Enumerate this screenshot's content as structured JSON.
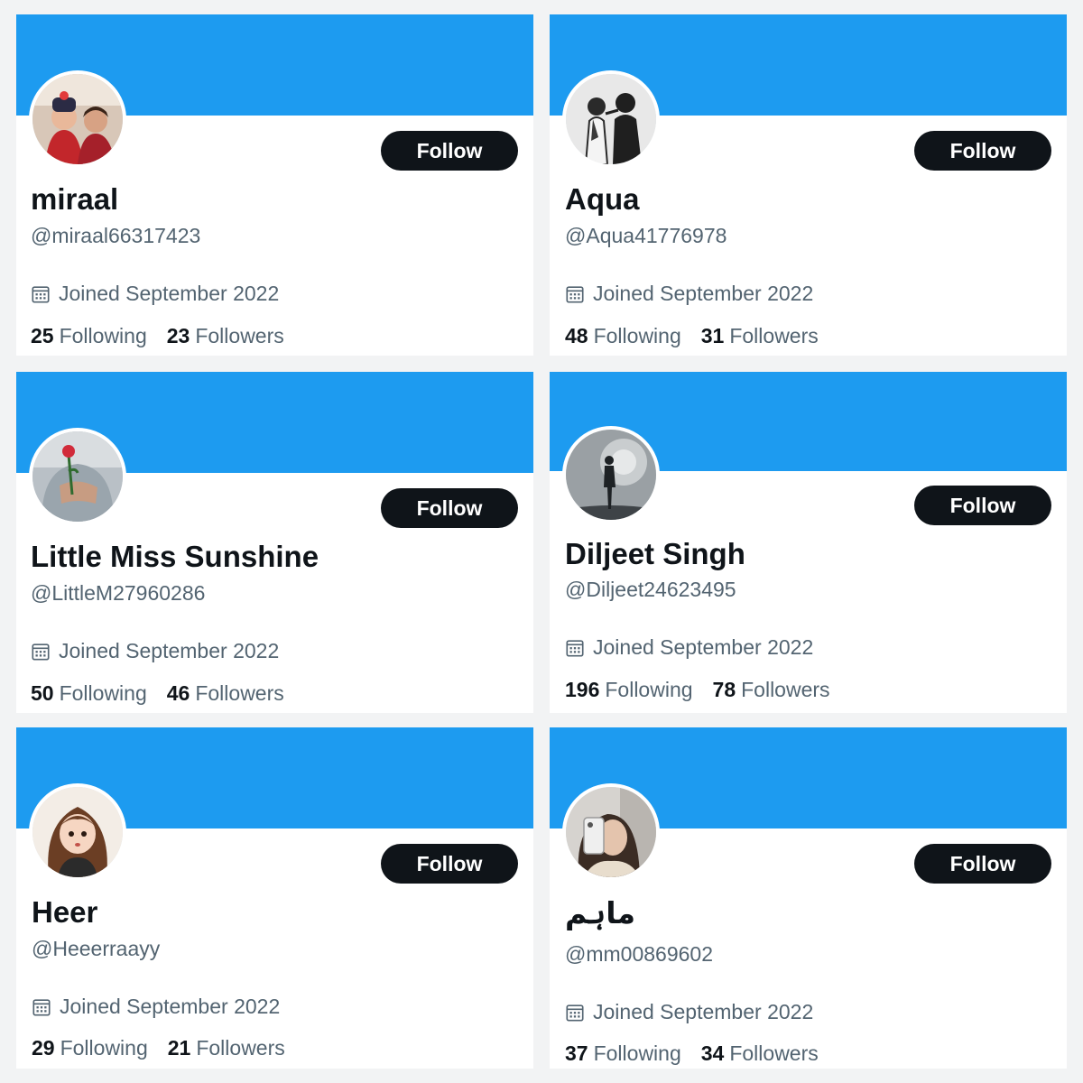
{
  "cards": [
    {
      "name": "miraal",
      "handle": "@miraal66317423",
      "joined": "Joined September 2022",
      "following_count": "25",
      "following_label": "Following",
      "followers_count": "23",
      "followers_label": "Followers",
      "follow_label": "Follow"
    },
    {
      "name": "Aqua",
      "handle": "@Aqua41776978",
      "joined": "Joined September 2022",
      "following_count": "48",
      "following_label": "Following",
      "followers_count": "31",
      "followers_label": "Followers",
      "follow_label": "Follow"
    },
    {
      "name": "Little Miss Sunshine",
      "handle": "@LittleM27960286",
      "joined": "Joined September 2022",
      "following_count": "50",
      "following_label": "Following",
      "followers_count": "46",
      "followers_label": "Followers",
      "follow_label": "Follow"
    },
    {
      "name": "Diljeet Singh",
      "handle": "@Diljeet24623495",
      "joined": "Joined September 2022",
      "following_count": "196",
      "following_label": "Following",
      "followers_count": "78",
      "followers_label": "Followers",
      "follow_label": "Follow"
    },
    {
      "name": "Heer",
      "handle": "@Heeerraayy",
      "joined": "Joined September 2022",
      "following_count": "29",
      "following_label": "Following",
      "followers_count": "21",
      "followers_label": "Followers",
      "follow_label": "Follow"
    },
    {
      "name": "ماہم",
      "handle": "@mm00869602",
      "joined": "Joined September 2022",
      "following_count": "37",
      "following_label": "Following",
      "followers_count": "34",
      "followers_label": "Followers",
      "follow_label": "Follow"
    }
  ],
  "colors": {
    "banner": "#1d9bf0",
    "button": "#0f1419",
    "secondary_text": "#536471"
  },
  "icons": {
    "calendar": "calendar-icon"
  }
}
